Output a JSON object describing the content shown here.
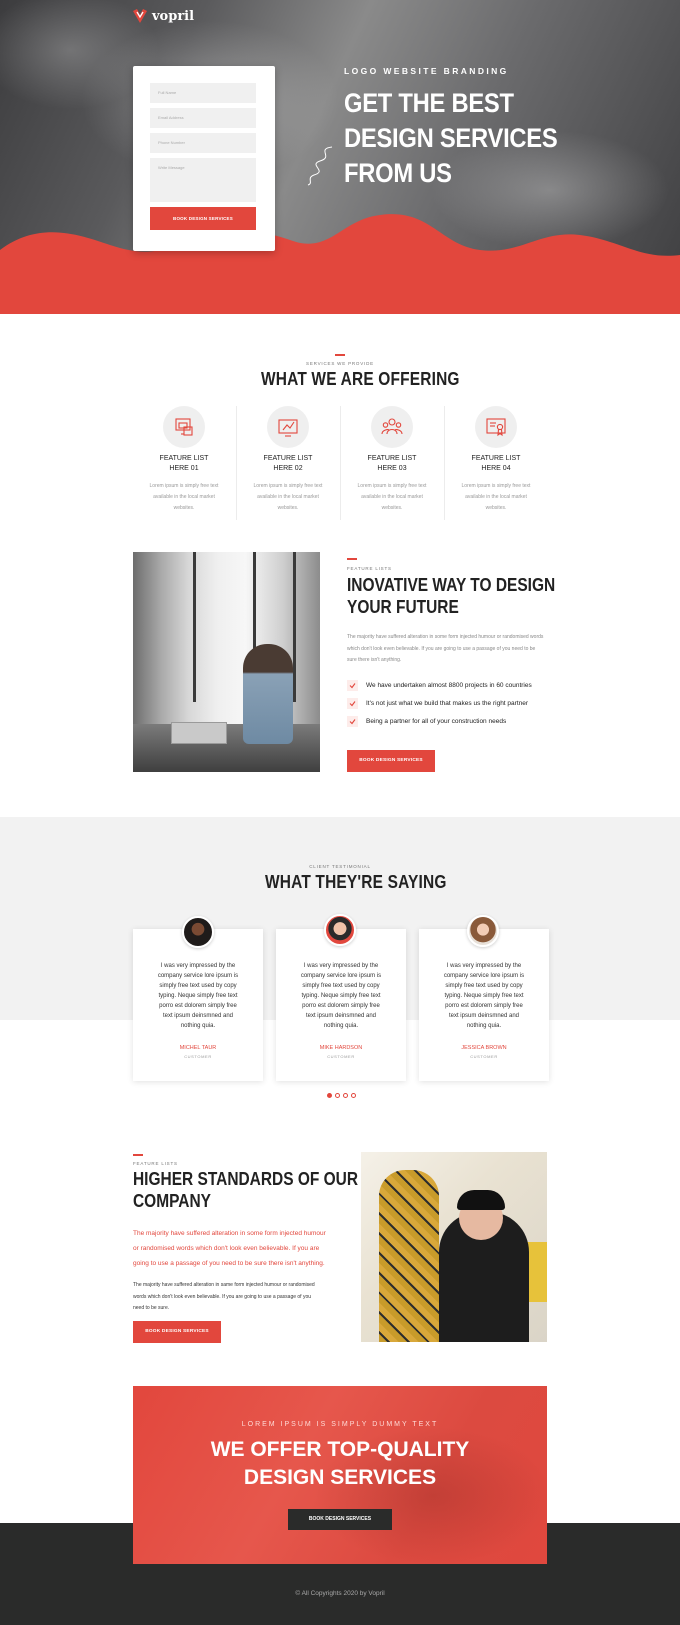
{
  "brand": {
    "name": "vopril",
    "accent": "#e2473d",
    "dark": "#2a2b2a"
  },
  "hero": {
    "tags": "LOGO   WEBSITE   BRANDING",
    "title_lines": [
      "GET THE BEST",
      "DESIGN SERVICES",
      "FROM US"
    ],
    "form": {
      "full_name_placeholder": "Full Name",
      "email_placeholder": "Email Address",
      "phone_placeholder": "Phone Number",
      "message_placeholder": "Write Message",
      "submit_label": "BOOK DESIGN SERVICES"
    }
  },
  "services": {
    "eyebrow": "SERVICES WE PROVIDE",
    "title": "WHAT WE ARE OFFERING",
    "features": [
      {
        "icon": "web-design-icon",
        "title_line1": "FEATURE LIST",
        "title_line2": "HERE 01",
        "desc": "Lorem ipsum is simply free text available in the local market websites."
      },
      {
        "icon": "graphic-design-icon",
        "title_line1": "FEATURE LIST",
        "title_line2": "HERE 02",
        "desc": "Lorem ipsum is simply free text available in the local market websites."
      },
      {
        "icon": "team-icon",
        "title_line1": "FEATURE LIST",
        "title_line2": "HERE 03",
        "desc": "Lorem ipsum is simply free text available in the local market websites."
      },
      {
        "icon": "certificate-icon",
        "title_line1": "FEATURE LIST",
        "title_line2": "HERE 04",
        "desc": "Lorem ipsum is simply free text available in the local market websites."
      }
    ]
  },
  "innovative": {
    "eyebrow": "FEATURE LISTS",
    "title_lines": [
      "INOVATIVE WAY TO DESIGN",
      "YOUR FUTURE"
    ],
    "paragraph": "The majority have suffered alteration in some form injected humour or randomised words which don't look even believable. If you are going to use a passage of you need to be sure there isn't anything.",
    "checklist": [
      "We have undertaken almost 8800 projects in 60 countries",
      "It's not just what we build that makes us the right partner",
      "Being a partner for all of your construction needs"
    ],
    "button_label": "BOOK DESIGN SERVICES"
  },
  "testimonials": {
    "eyebrow": "CLIENT TESTIMONIAL",
    "title": "WHAT THEY'RE SAYING",
    "items": [
      {
        "quote": "I was very impressed by the company service lore ipsum is simply free text used by copy typing. Neque simply free text porro est dolorem simply free text ipsum deinsmned and nothing quia.",
        "name": "MICHEL TAUR",
        "role": "CUSTOMER"
      },
      {
        "quote": "I was very impressed by the company service lore ipsum is simply free text used by copy typing. Neque simply free text porro est dolorem simply free text ipsum deinsmned and nothing quia.",
        "name": "MIKE HARDSON",
        "role": "CUSTOMER"
      },
      {
        "quote": "I was very impressed by the company service lore ipsum is simply free text used by copy typing. Neque simply free text porro est dolorem simply free text ipsum deinsmned and nothing quia.",
        "name": "JESSICA BROWN",
        "role": "CUSTOMER"
      }
    ],
    "active_slide": 1,
    "slide_count": 4
  },
  "standards": {
    "eyebrow": "FEATURE LISTS",
    "title_lines": [
      "HIGHER STANDARDS OF OUR",
      "COMPANY"
    ],
    "lead": "The majority have suffered alteration in some form injected humour or randomised words which don't look even believable. If you are going to use a passage of you need to be sure there isn't anything.",
    "body": "The majority have suffered alteration in same form injected humour or randomised words which don't look even believable. If you are going to use a passage of you need to be sure.",
    "button_label": "BOOK DESIGN SERVICES"
  },
  "cta": {
    "eyebrow": "LOREM IPSUM IS SIMPLY DUMMY TEXT",
    "title_lines": [
      "WE OFFER TOP-QUALITY",
      "DESIGN SERVICES"
    ],
    "button_label": "BOOK DESIGN SERVICES"
  },
  "footer": {
    "copyright": "© All Copyrights 2020 by Vopril"
  }
}
